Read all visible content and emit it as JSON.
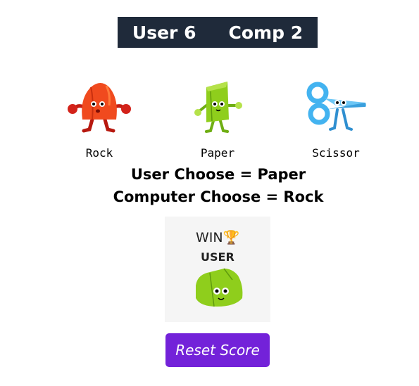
{
  "score": {
    "user_label": "User",
    "user_score": "6",
    "comp_label": "Comp",
    "comp_score": "2"
  },
  "choices": [
    {
      "label": "Rock",
      "icon": "rock-character-icon",
      "color": "#f04a1e"
    },
    {
      "label": "Paper",
      "icon": "paper-character-icon",
      "color": "#8fce1c"
    },
    {
      "label": "Scissor",
      "icon": "scissor-character-icon",
      "color": "#43b3f0"
    }
  ],
  "result": {
    "user_choose": "User Choose = Paper",
    "computer_choose": "Computer Choose = Rock",
    "win_text": "WIN",
    "trophy": "🏆",
    "winner": "USER",
    "winner_icon": "paper-character-icon"
  },
  "reset_label": "Reset Score",
  "colors": {
    "scoreboard_bg": "#1f2a3a",
    "button_bg": "#7322d9",
    "card_bg": "#f5f5f5"
  }
}
